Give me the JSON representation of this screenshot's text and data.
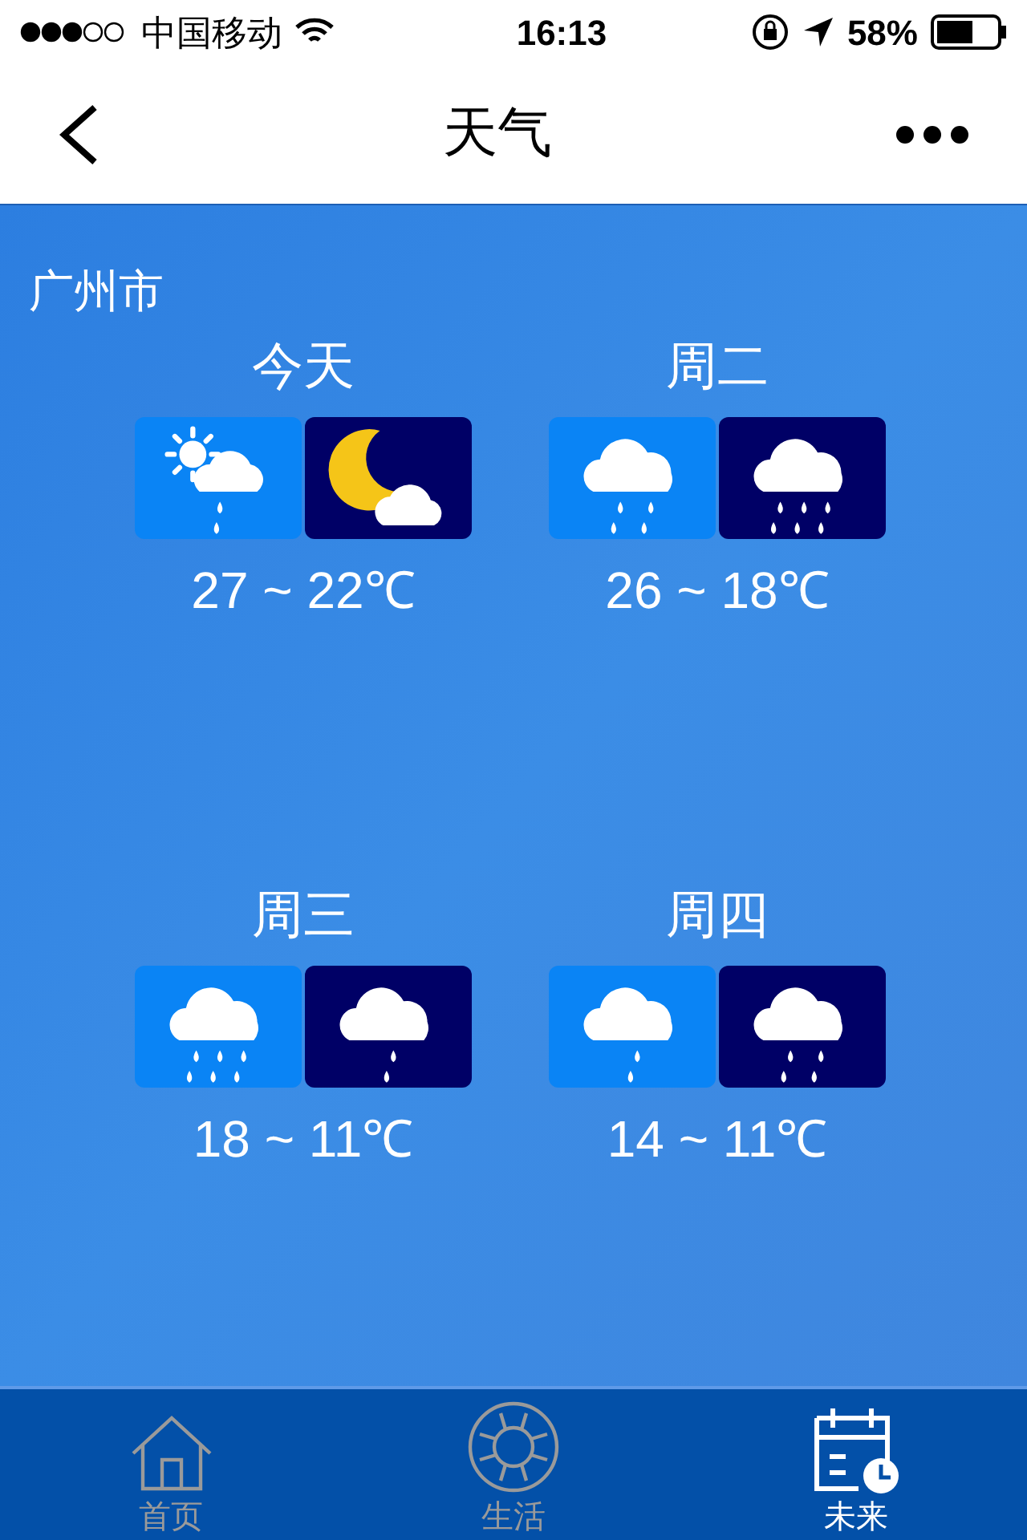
{
  "status_bar": {
    "carrier": "中国移动",
    "time": "16:13",
    "battery": "58%"
  },
  "nav": {
    "title": "天气"
  },
  "city": "广州市",
  "days": [
    {
      "label": "今天",
      "temps": "27 ~ 22℃",
      "icons": [
        {
          "night": false,
          "kind": "sun-cloud-rain"
        },
        {
          "night": true,
          "kind": "moon-cloud"
        }
      ]
    },
    {
      "label": "周二",
      "temps": "26 ~ 18℃",
      "icons": [
        {
          "night": false,
          "kind": "rain-4"
        },
        {
          "night": true,
          "kind": "rain-6"
        }
      ]
    },
    {
      "label": "周三",
      "temps": "18 ~ 11℃",
      "icons": [
        {
          "night": false,
          "kind": "rain-6"
        },
        {
          "night": true,
          "kind": "rain-2"
        }
      ]
    },
    {
      "label": "周四",
      "temps": "14 ~ 11℃",
      "icons": [
        {
          "night": false,
          "kind": "rain-2"
        },
        {
          "night": true,
          "kind": "rain-4"
        }
      ]
    }
  ],
  "tabs": [
    {
      "label": "首页",
      "selected": false
    },
    {
      "label": "生活",
      "selected": false
    },
    {
      "label": "未来",
      "selected": true
    }
  ]
}
